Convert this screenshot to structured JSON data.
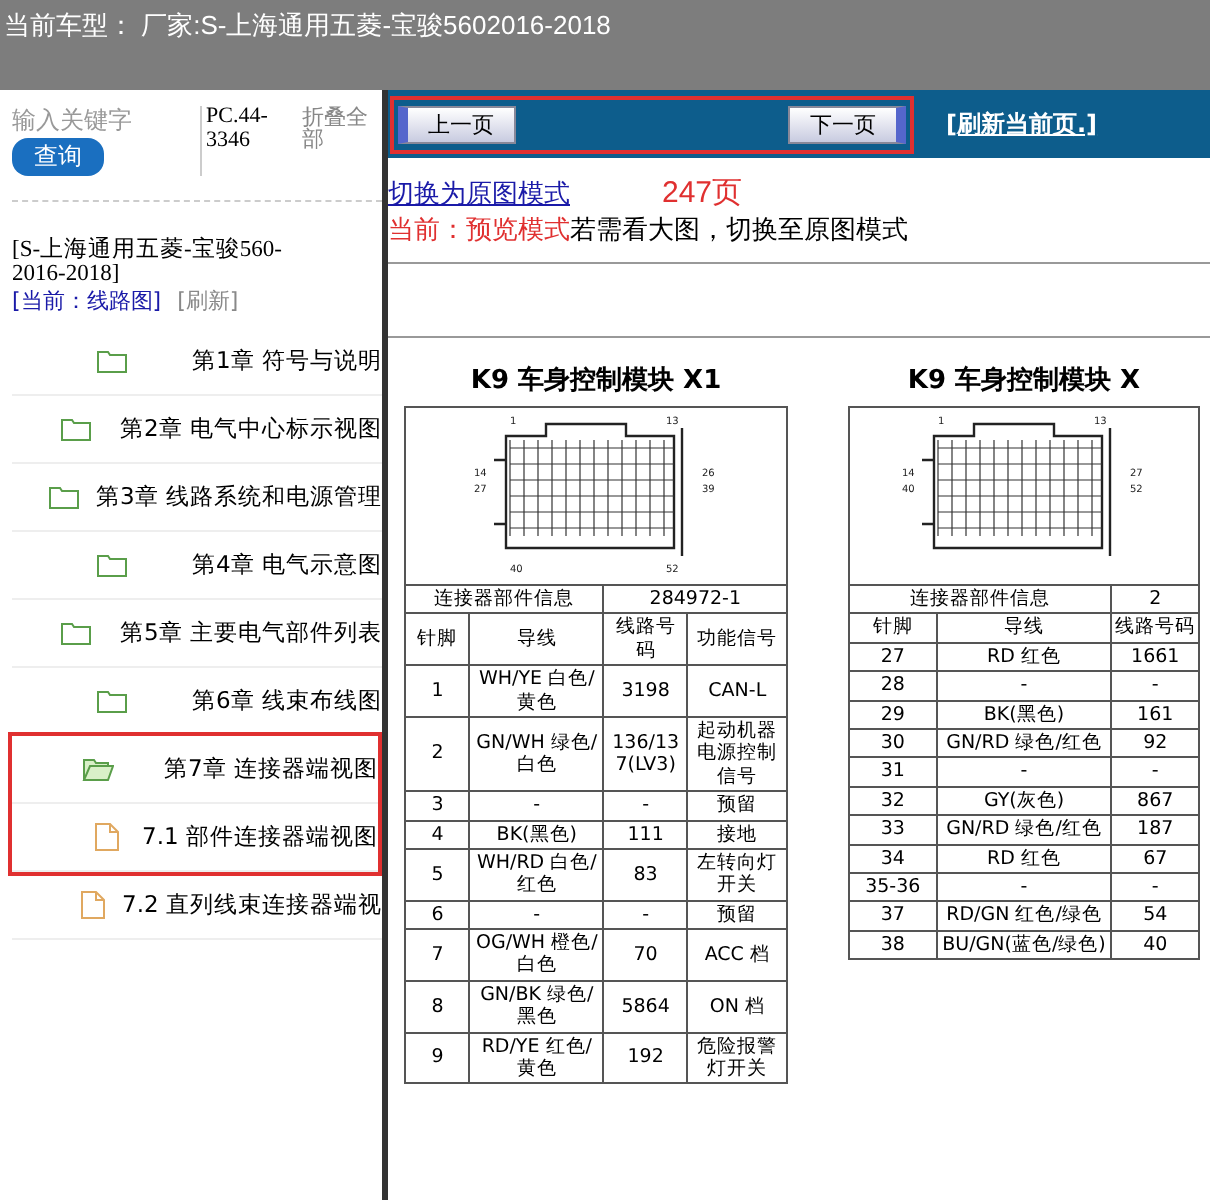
{
  "window": {
    "title": "当前车型： 厂家:S-上海通用五菱-宝骏5602016-2018"
  },
  "sidebar": {
    "search": {
      "placeholder": "输入关键字"
    },
    "search_button": "查询",
    "code": "PC.44-3346",
    "collapse_all": "折叠全部",
    "model": "[S-上海通用五菱-宝骏560-2016-2018]",
    "current": "[当前：线路图]",
    "refresh": "[刷新]",
    "items": [
      {
        "label": "第1章 符号与说明",
        "expanded": false,
        "highlighted": false
      },
      {
        "label": "第2章 电气中心标示视图",
        "expanded": false,
        "highlighted": false
      },
      {
        "label": "第3章 线路系统和电源管理",
        "expanded": false,
        "highlighted": false
      },
      {
        "label": "第4章 电气示意图",
        "expanded": false,
        "highlighted": false
      },
      {
        "label": "第5章 主要电气部件列表",
        "expanded": false,
        "highlighted": false
      },
      {
        "label": "第6章 线束布线图",
        "expanded": false,
        "highlighted": false
      },
      {
        "label": "第7章 连接器端视图",
        "expanded": true,
        "highlighted": true,
        "children": [
          {
            "label": "7.1 部件连接器端视图"
          }
        ]
      },
      {
        "label": "7.2 直列线束连接器端视",
        "expanded": false,
        "highlighted": false,
        "kind": "page"
      }
    ]
  },
  "nav": {
    "prev": "上一页",
    "next": "下一页",
    "highlighted": true,
    "refresh": "[刷新当前页.]"
  },
  "viewer": {
    "switch_link": "切换为原图模式",
    "page_count": "247页",
    "mode": "当前：预览模式",
    "hint": "若需看大图，切换至原图模式"
  },
  "document": {
    "tables": [
      {
        "title": "K9 车身控制模块 X1",
        "pins": [
          "1",
          "13",
          "14",
          "26",
          "27",
          "39",
          "40",
          "52"
        ],
        "info_label": "连接器部件信息",
        "info_value": "284972-1",
        "columns": [
          "针脚",
          "导线",
          "线路号码",
          "功能信号"
        ],
        "rows": [
          [
            "1",
            "WH/YE 白色/黄色",
            "3198",
            "CAN-L"
          ],
          [
            "2",
            "GN/WH 绿色/白色",
            "136/137(LV3)",
            "起动机器电源控制信号"
          ],
          [
            "3",
            "-",
            "-",
            "预留"
          ],
          [
            "4",
            "BK(黑色)",
            "111",
            "接地"
          ],
          [
            "5",
            "WH/RD 白色/红色",
            "83",
            "左转向灯开关"
          ],
          [
            "6",
            "-",
            "-",
            "预留"
          ],
          [
            "7",
            "OG/WH 橙色/白色",
            "70",
            "ACC 档"
          ],
          [
            "8",
            "GN/BK 绿色/黑色",
            "5864",
            "ON 档"
          ],
          [
            "9",
            "RD/YE 红色/黄色",
            "192",
            "危险报警灯开关"
          ]
        ]
      },
      {
        "title": "K9 车身控制模块 X",
        "pins": [
          "1",
          "13",
          "14",
          "27",
          "40",
          "52"
        ],
        "info_label": "连接器部件信息",
        "info_value": "2",
        "columns": [
          "针脚",
          "导线",
          "线路号码"
        ],
        "rows": [
          [
            "27",
            "RD 红色",
            "1661"
          ],
          [
            "28",
            "-",
            "-"
          ],
          [
            "29",
            "BK(黑色)",
            "161"
          ],
          [
            "30",
            "GN/RD 绿色/红色",
            "92"
          ],
          [
            "31",
            "-",
            "-"
          ],
          [
            "32",
            "GY(灰色)",
            "867"
          ],
          [
            "33",
            "GN/RD 绿色/红色",
            "187"
          ],
          [
            "34",
            "RD 红色",
            "67"
          ],
          [
            "35-36",
            "-",
            "-"
          ],
          [
            "37",
            "RD/GN 红色/绿色",
            "54"
          ],
          [
            "38",
            "BU/GN(蓝色/绿色)",
            "40"
          ]
        ]
      }
    ]
  }
}
